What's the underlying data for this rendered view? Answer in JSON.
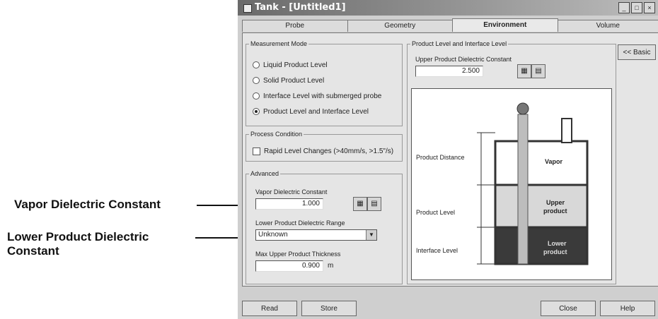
{
  "callouts": {
    "vapor": "Vapor Dielectric Constant",
    "lower_line1": "Lower Product Dielectric",
    "lower_line2": "Constant"
  },
  "window": {
    "title": "Tank - [Untitled1]",
    "buttons": [
      "_",
      "□",
      "×"
    ]
  },
  "tabs": [
    "Probe",
    "Geometry",
    "Environment",
    "Volume"
  ],
  "active_tab": "Environment",
  "measurement_mode": {
    "legend": "Measurement Mode",
    "options": [
      "Liquid Product Level",
      "Solid Product Level",
      "Interface Level with submerged probe",
      "Product Level and Interface Level"
    ],
    "selected": "Product Level and Interface Level"
  },
  "process_condition": {
    "legend": "Process Condition",
    "rapid_label": "Rapid Level Changes (>40mm/s, >1.5\"/s)"
  },
  "advanced": {
    "legend": "Advanced",
    "vapor_label": "Vapor Dielectric Constant",
    "vapor_value": "1.000",
    "lower_label": "Lower Product Dielectric Range",
    "lower_value": "Unknown",
    "thickness_label": "Max Upper Product Thickness",
    "thickness_value": "0.900",
    "thickness_unit": "m"
  },
  "product_interface": {
    "legend": "Product Level and Interface Level",
    "upper_label": "Upper Product Dielectric Constant",
    "upper_value": "2.500"
  },
  "diagram": {
    "labels": {
      "distance": "Product Distance",
      "level": "Product Level",
      "interface": "Interface Level",
      "vapor": "Vapor",
      "upper1": "Upper",
      "upper2": "product",
      "lower1": "Lower",
      "lower2": "product"
    }
  },
  "basic_button": "<< Basic",
  "bottom_buttons": {
    "read": "Read",
    "store": "Store",
    "close": "Close",
    "help": "Help"
  },
  "colors": {
    "vapor": "#ffffff",
    "upper": "#d8d8d8",
    "lower": "#3a3a3a"
  }
}
